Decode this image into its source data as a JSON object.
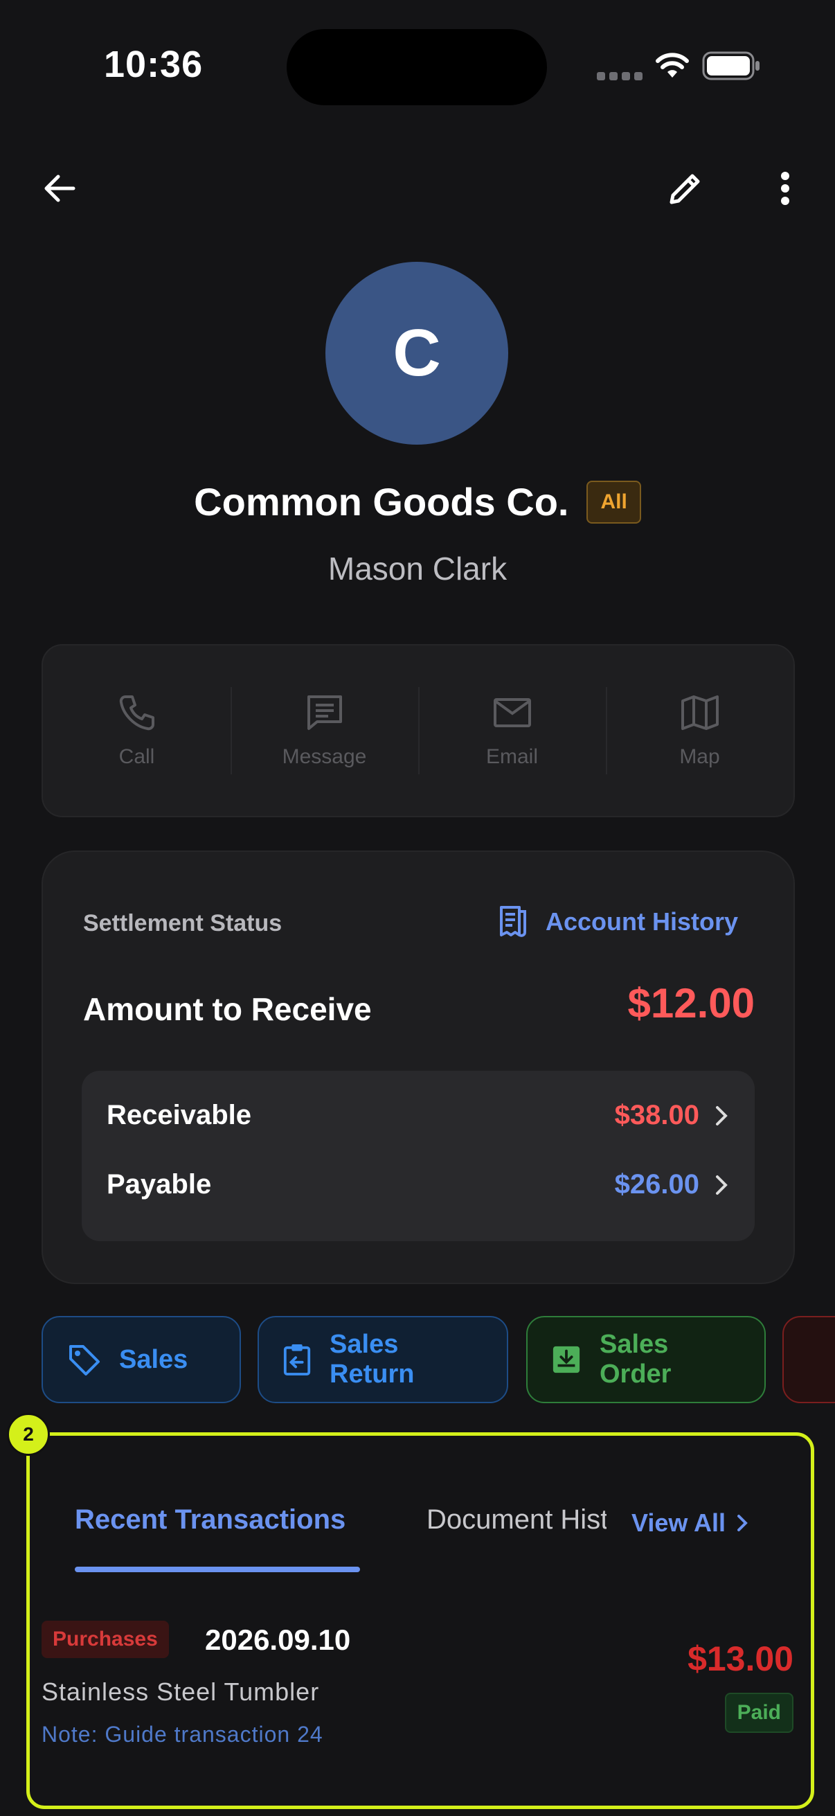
{
  "status_bar": {
    "time": "10:36"
  },
  "profile": {
    "initial": "C",
    "name": "Common Goods Co.",
    "tag": "All",
    "contact_person": "Mason Clark"
  },
  "quick_actions": [
    {
      "label": "Call",
      "icon": "phone-icon"
    },
    {
      "label": "Message",
      "icon": "message-icon"
    },
    {
      "label": "Email",
      "icon": "email-icon"
    },
    {
      "label": "Map",
      "icon": "map-icon"
    }
  ],
  "settlement": {
    "label": "Settlement Status",
    "history_link": "Account History",
    "amount_label": "Amount to Receive",
    "amount_value": "$12.00",
    "receivable_label": "Receivable",
    "receivable_value": "$38.00",
    "payable_label": "Payable",
    "payable_value": "$26.00"
  },
  "doc_types": [
    {
      "label": "Sales",
      "icon": "tag-icon"
    },
    {
      "label": "Sales Return",
      "icon": "return-icon"
    },
    {
      "label": "Sales Order",
      "icon": "download-box-icon"
    }
  ],
  "transactions": {
    "annotation_badge": "2",
    "tab_recent": "Recent Transactions",
    "tab_document": "Document History",
    "view_all": "View All",
    "items": [
      {
        "type": "Purchases",
        "date": "2026.09.10",
        "item": "Stainless Steel Tumbler",
        "note": "Note: Guide transaction 24",
        "amount": "$13.00",
        "status": "Paid"
      }
    ]
  },
  "colors": {
    "accent": "#6b93f0",
    "negative": "#ff5a5a",
    "highlight": "#d4f01a"
  }
}
